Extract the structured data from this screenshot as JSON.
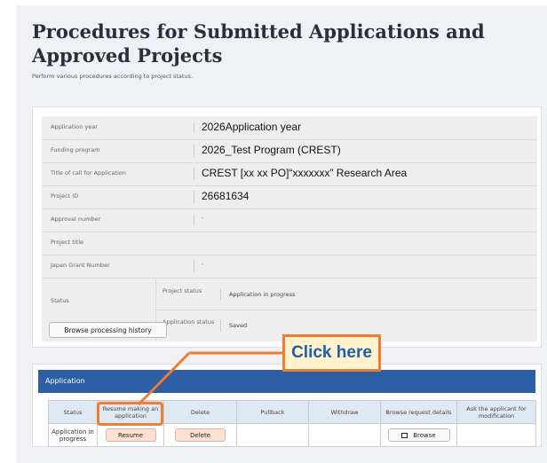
{
  "page": {
    "title": "Procedures for Submitted Applications and Approved Projects",
    "subtitle": "Perform various procedures according to project status."
  },
  "info": {
    "rows": [
      {
        "label": "Application year",
        "value": "2026Application year"
      },
      {
        "label": "Funding program",
        "value": "2026_Test Program (CREST)"
      },
      {
        "label": "Title of call for Application",
        "value": "CREST [xx xx PO]“xxxxxxx” Research Area"
      },
      {
        "label": "Project ID",
        "value": "26681634"
      },
      {
        "label": "Approval number",
        "value": "-"
      },
      {
        "label": "Project title",
        "value": ""
      },
      {
        "label": "Japan Grant Number",
        "value": "-"
      }
    ],
    "status": {
      "label": "Status",
      "project_status_label": "Project status",
      "project_status_value": "Application in progress",
      "application_status_label": "Application status",
      "application_status_value": "Saved",
      "history_button": "Browse processing history"
    }
  },
  "application": {
    "header": "Application",
    "columns": [
      "Status",
      "Resume making an application",
      "Delete",
      "Pullback",
      "Withdraw",
      "Browse request details",
      "Ask the applicant for modification"
    ],
    "row": {
      "status": "Application in progress",
      "resume_button": "Resume",
      "delete_button": "Delete",
      "browse_button": "Browse"
    }
  },
  "annotation": {
    "callout_text": "Click here",
    "color": "#ee7d31"
  },
  "colors": {
    "header_blue": "#2d5fa6",
    "button_orange_bg": "#fbe1d4",
    "callout_text": "#1f5faa"
  }
}
